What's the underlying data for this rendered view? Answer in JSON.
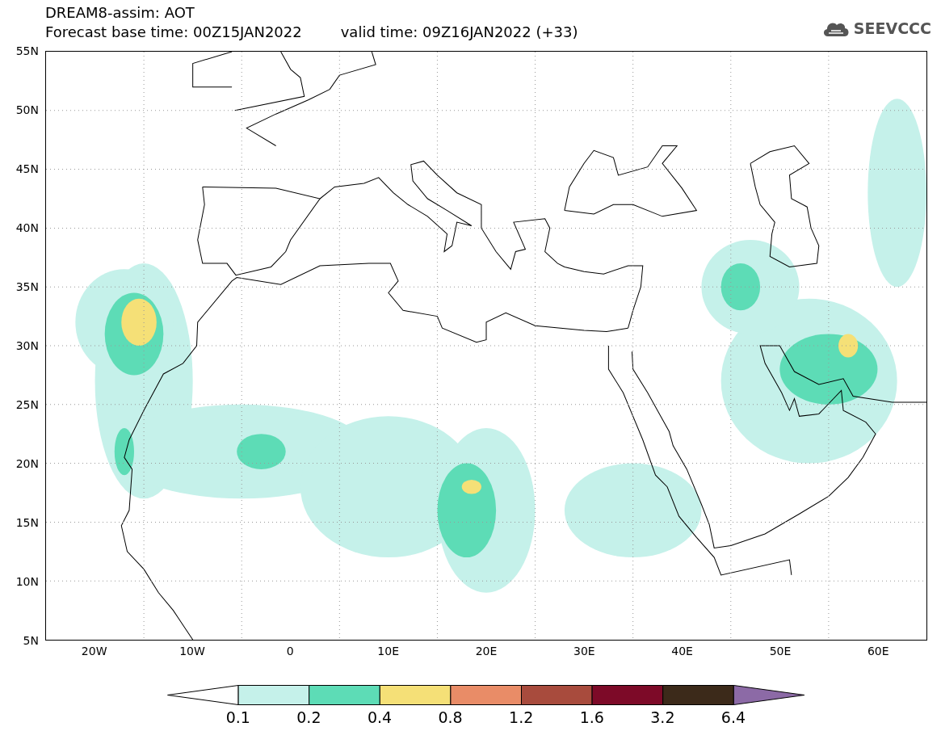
{
  "title": "DREAM8-assim: AOT",
  "base_time": "Forecast base time: 00Z15JAN2022",
  "valid_time": "valid time: 09Z16JAN2022 (+33)",
  "logo": "SEEVCCC",
  "y_axis": [
    "55N",
    "50N",
    "45N",
    "40N",
    "35N",
    "30N",
    "25N",
    "20N",
    "15N",
    "10N",
    "5N"
  ],
  "x_axis": [
    "20W",
    "10W",
    "0",
    "10E",
    "20E",
    "30E",
    "40E",
    "50E",
    "60E"
  ],
  "legend": {
    "bins": [
      {
        "kind": "low-arrow",
        "color": "#ffffff"
      },
      {
        "kind": "box",
        "color": "#c5f1ea"
      },
      {
        "kind": "box",
        "color": "#5ddcb6"
      },
      {
        "kind": "box",
        "color": "#f5e077"
      },
      {
        "kind": "box",
        "color": "#e98c67"
      },
      {
        "kind": "box",
        "color": "#a84b3d"
      },
      {
        "kind": "box",
        "color": "#7d0a28"
      },
      {
        "kind": "box",
        "color": "#3c2a1a"
      },
      {
        "kind": "high-arrow",
        "color": "#8c6aa6"
      }
    ],
    "labels": [
      "0.1",
      "0.2",
      "0.4",
      "0.8",
      "1.2",
      "1.6",
      "3.2",
      "6.4"
    ]
  }
}
